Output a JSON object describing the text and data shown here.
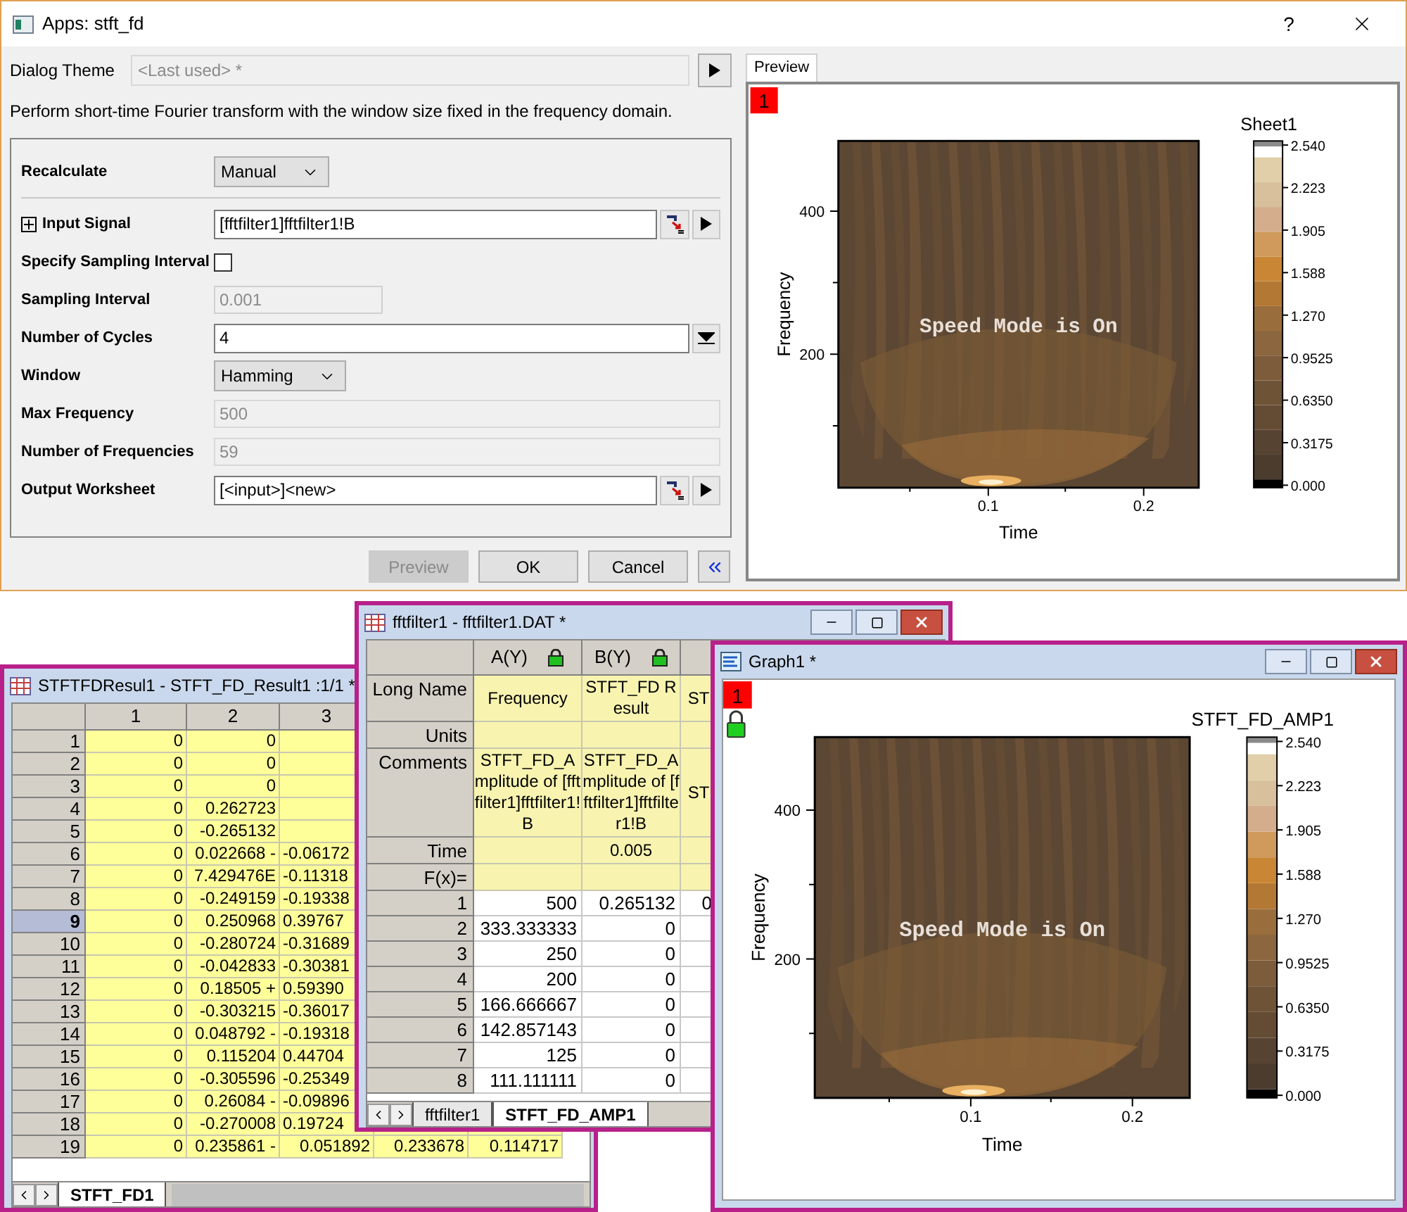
{
  "dialog": {
    "title": "Apps: stft_fd",
    "help": "?",
    "theme_label": "Dialog Theme",
    "theme_value": "<Last used> *",
    "description": "Perform short-time Fourier transform with the window size fixed in the frequency domain.",
    "fields": [
      {
        "kind": "dropdown",
        "label": "Recalculate",
        "value": "Manual"
      },
      {
        "kind": "separator"
      },
      {
        "kind": "range",
        "label": "Input Signal",
        "value": "[fftfilter1]fftfilter1!B",
        "expanded": false
      },
      {
        "kind": "checkbox",
        "label": "Specify Sampling Interval",
        "checked": false
      },
      {
        "kind": "number",
        "label": "Sampling Interval",
        "value": "0.001",
        "disabled": true
      },
      {
        "kind": "combo",
        "label": "Number of Cycles",
        "value": "4"
      },
      {
        "kind": "dropdown",
        "label": "Window",
        "value": "Hamming"
      },
      {
        "kind": "readonly",
        "label": "Max Frequency",
        "value": "500"
      },
      {
        "kind": "readonly",
        "label": "Number of Frequencies",
        "value": "59"
      },
      {
        "kind": "range",
        "label": "Output Worksheet",
        "value": "[<input>]<new>"
      }
    ],
    "buttons": [
      {
        "label": "Preview",
        "disabled": true
      },
      {
        "label": "OK",
        "disabled": false
      },
      {
        "label": "Cancel",
        "disabled": false
      }
    ],
    "preview_tab": {
      "label": "Preview",
      "selected": true
    },
    "preview_plot": {
      "layer": "1",
      "locked": false,
      "colorbar_title": "Sheet1",
      "overlay": "Speed Mode is On",
      "xlabel": "Time",
      "ylabel": "Frequency",
      "xticks": [
        "0.1",
        "0.2"
      ],
      "yticks": [
        "400",
        "200"
      ],
      "colorbar_ticks": [
        "2.540",
        "2.223",
        "1.905",
        "1.588",
        "1.270",
        "0.9525",
        "0.6350",
        "0.3175",
        "0.000"
      ]
    }
  },
  "result_sheet": {
    "title": "STFTFDResul1 - STFT_FD_Result1 :1/1  *",
    "columns": [
      "1",
      "2",
      "3"
    ],
    "rows": [
      {
        "label": "1",
        "selected": false,
        "cells": [
          "0",
          "0"
        ]
      },
      {
        "label": "2",
        "selected": false,
        "cells": [
          "0",
          "0"
        ]
      },
      {
        "label": "3",
        "selected": false,
        "cells": [
          "0",
          "0"
        ]
      },
      {
        "label": "4",
        "selected": false,
        "cells": [
          "0",
          "0.262723"
        ]
      },
      {
        "label": "5",
        "selected": false,
        "cells": [
          "0",
          "-0.265132"
        ]
      },
      {
        "label": "6",
        "selected": false,
        "cells": [
          "0",
          "0.022668 -",
          "-0.06172"
        ]
      },
      {
        "label": "7",
        "selected": false,
        "cells": [
          "0",
          "7.429476E",
          "-0.11318"
        ]
      },
      {
        "label": "8",
        "selected": false,
        "cells": [
          "0",
          "-0.249159",
          "-0.19338"
        ]
      },
      {
        "label": "9",
        "selected": true,
        "cells": [
          "0",
          "0.250968",
          "0.39767"
        ]
      },
      {
        "label": "10",
        "selected": false,
        "cells": [
          "0",
          "-0.280724",
          "-0.31689"
        ]
      },
      {
        "label": "11",
        "selected": false,
        "cells": [
          "0",
          "-0.042833",
          "-0.30381"
        ]
      },
      {
        "label": "12",
        "selected": false,
        "cells": [
          "0",
          "0.18505 +",
          "0.59390"
        ]
      },
      {
        "label": "13",
        "selected": false,
        "cells": [
          "0",
          "-0.303215",
          "-0.36017"
        ]
      },
      {
        "label": "14",
        "selected": false,
        "cells": [
          "0",
          "0.048792 -",
          "-0.19318"
        ]
      },
      {
        "label": "15",
        "selected": false,
        "cells": [
          "0",
          "0.115204",
          "0.44704"
        ]
      },
      {
        "label": "16",
        "selected": false,
        "cells": [
          "0",
          "-0.305596",
          "-0.25349"
        ]
      },
      {
        "label": "17",
        "selected": false,
        "cells": [
          "0",
          "0.26084 -",
          "-0.09896"
        ]
      },
      {
        "label": "18",
        "selected": false,
        "cells": [
          "0",
          "-0.270008",
          "0.19724"
        ]
      },
      {
        "label": "19",
        "selected": false,
        "cells": [
          "0",
          "0.235861 -",
          "0.051892",
          "0.233678",
          "0.114717"
        ]
      }
    ],
    "sheets": [
      {
        "label": "STFT_FD1",
        "selected": true
      }
    ]
  },
  "data_sheet": {
    "title": "fftfilter1 - fftfilter1.DAT *",
    "columns": [
      {
        "label": "A(Y)",
        "locked": true
      },
      {
        "label": "B(Y)",
        "locked": true
      }
    ],
    "header_rows": [
      {
        "label": "Long Name",
        "cells": [
          "Frequency",
          "STFT_FD Result",
          "ST"
        ]
      },
      {
        "label": "Units",
        "cells": []
      },
      {
        "label": "Comments",
        "cells": [
          "STFT_FD_Amplitude of [fftfilter1]fftfilter1!B",
          "STFT_FD_Amplitude of [fftfilter1]fftfilter1!B",
          "ST"
        ]
      },
      {
        "label": "Time",
        "cells": [
          null,
          "0.005"
        ]
      },
      {
        "label": "F(x)=",
        "cells": []
      }
    ],
    "rows": [
      {
        "label": "1",
        "cells": [
          "500",
          "0.265132",
          "0"
        ]
      },
      {
        "label": "2",
        "cells": [
          "333.333333",
          "0"
        ]
      },
      {
        "label": "3",
        "cells": [
          "250",
          "0"
        ]
      },
      {
        "label": "4",
        "cells": [
          "200",
          "0"
        ]
      },
      {
        "label": "5",
        "cells": [
          "166.666667",
          "0"
        ]
      },
      {
        "label": "6",
        "cells": [
          "142.857143",
          "0"
        ]
      },
      {
        "label": "7",
        "cells": [
          "125",
          "0"
        ]
      },
      {
        "label": "8",
        "cells": [
          "111.111111",
          "0"
        ]
      }
    ],
    "sheets": [
      {
        "label": "fftfilter1",
        "selected": false
      },
      {
        "label": "STFT_FD_AMP1",
        "selected": true
      }
    ]
  },
  "graph": {
    "title": "Graph1 *",
    "plot": {
      "layer": "1",
      "locked": true,
      "colorbar_title": "STFT_FD_AMP1",
      "overlay": "Speed Mode is On",
      "xlabel": "Time",
      "ylabel": "Frequency",
      "xticks": [
        "0.1",
        "0.2"
      ],
      "yticks": [
        "400",
        "200"
      ],
      "colorbar_ticks": [
        "2.540",
        "2.223",
        "1.905",
        "1.588",
        "1.270",
        "0.9525",
        "0.6350",
        "0.3175",
        "0.000"
      ]
    }
  }
}
